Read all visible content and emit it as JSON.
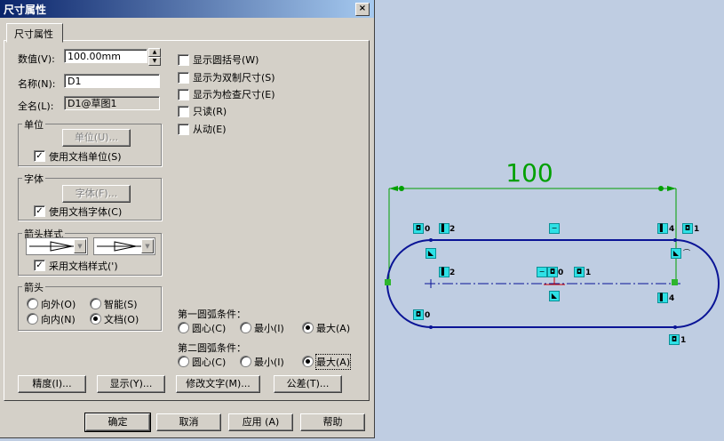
{
  "window": {
    "title": "尺寸属性",
    "close_icon": "×"
  },
  "tab": {
    "label": "尺寸属性"
  },
  "fields": {
    "value_label": "数值(V):",
    "value": "100.00mm",
    "name_label": "名称(N):",
    "name": "D1",
    "fullname_label": "全名(L):",
    "fullname": "D1@草图1"
  },
  "options": [
    {
      "label": "显示圆括号(W)",
      "checked": false
    },
    {
      "label": "显示为双制尺寸(S)",
      "checked": false
    },
    {
      "label": "显示为检查尺寸(E)",
      "checked": false
    },
    {
      "label": "只读(R)",
      "checked": false
    },
    {
      "label": "从动(E)",
      "checked": false
    }
  ],
  "units_group": {
    "title": "单位",
    "button": "单位(U)...",
    "checkbox": "使用文档单位(S)",
    "checked": true
  },
  "font_group": {
    "title": "字体",
    "button": "字体(F)...",
    "checkbox": "使用文档字体(C)",
    "checked": true
  },
  "arrowstyle_group": {
    "title": "箭头样式",
    "checkbox": "采用文档样式(')",
    "checked": true
  },
  "arrow_group": {
    "title": "箭头",
    "outside": "向外(O)",
    "smart": "智能(S)",
    "inside": "向内(N)",
    "document": "文档(O)",
    "selected": "document"
  },
  "arc1": {
    "title": "第一圆弧条件：",
    "center": "圆心(C)",
    "min": "最小(I)",
    "max": "最大(A)",
    "selected": "max"
  },
  "arc2": {
    "title": "第二圆弧条件：",
    "center": "圆心(C)",
    "min": "最小(I)",
    "max": "最大(A)",
    "selected": "max"
  },
  "action_buttons": {
    "precision": "精度(I)...",
    "display": "显示(Y)...",
    "modify_text": "修改文字(M)...",
    "tolerance": "公差(T)..."
  },
  "footer": {
    "ok": "确定",
    "cancel": "取消",
    "apply": "应用 (A)",
    "help": "帮助"
  },
  "sketch": {
    "dimension": "100",
    "relations": {
      "r_top_left": "0",
      "r_top_left_line": "2",
      "r_top_right_line": "4",
      "r_top_right": "1",
      "r_mid_left": "2",
      "r_center": "0",
      "r_center_b": "1",
      "r_right_mid": "4",
      "r_bottom_left": "0",
      "r_bottom_right": "1"
    },
    "colors": {
      "geometry": "#0a1496",
      "dimension": "#00a000",
      "point": "#2db52d",
      "background": "#bfcde2"
    }
  }
}
